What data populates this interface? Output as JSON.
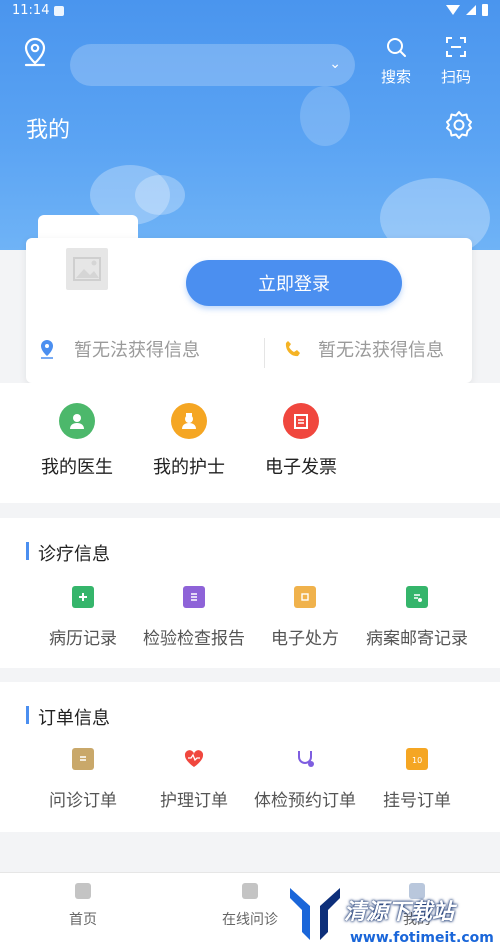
{
  "status_bar": {
    "time": "11:14"
  },
  "header": {
    "title": "我的",
    "search_label": "搜索",
    "scan_label": "扫码"
  },
  "profile": {
    "login_label": "立即登录",
    "location_info": "暂无法获得信息",
    "phone_info": "暂无法获得信息"
  },
  "quick_links": [
    {
      "label": "我的医生",
      "icon": "doctor-icon",
      "color": "#4cb86b"
    },
    {
      "label": "我的护士",
      "icon": "nurse-icon",
      "color": "#f5a623"
    },
    {
      "label": "电子发票",
      "icon": "invoice-icon",
      "color": "#f0473e"
    }
  ],
  "clinic_section": {
    "title": "诊疗信息",
    "items": [
      {
        "label": "病历记录",
        "icon": "medical-record-icon",
        "color": "#35b56b"
      },
      {
        "label": "检验检查报告",
        "icon": "report-icon",
        "color": "#8e63d8"
      },
      {
        "label": "电子处方",
        "icon": "prescription-icon",
        "color": "#f0b24c"
      },
      {
        "label": "病案邮寄记录",
        "icon": "mail-record-icon",
        "color": "#35b56b"
      }
    ]
  },
  "order_section": {
    "title": "订单信息",
    "items": [
      {
        "label": "问诊订单",
        "icon": "consult-order-icon",
        "color": "#c9a86a"
      },
      {
        "label": "护理订单",
        "icon": "heart-icon",
        "color": "#f0473e"
      },
      {
        "label": "体检预约订单",
        "icon": "checkup-icon",
        "color": "#7e5ee0"
      },
      {
        "label": "挂号订单",
        "icon": "calendar-icon",
        "color": "#f5a623"
      }
    ]
  },
  "bottom_nav": [
    {
      "label": "首页",
      "icon": "home-icon"
    },
    {
      "label": "在线问诊",
      "icon": "consult-icon"
    },
    {
      "label": "我的",
      "icon": "user-icon"
    }
  ],
  "watermark": {
    "text": "清源下载站",
    "url": "www.fotimeit.com"
  },
  "colors": {
    "primary": "#4b8ff0",
    "header_bg": "#4a95ee"
  }
}
